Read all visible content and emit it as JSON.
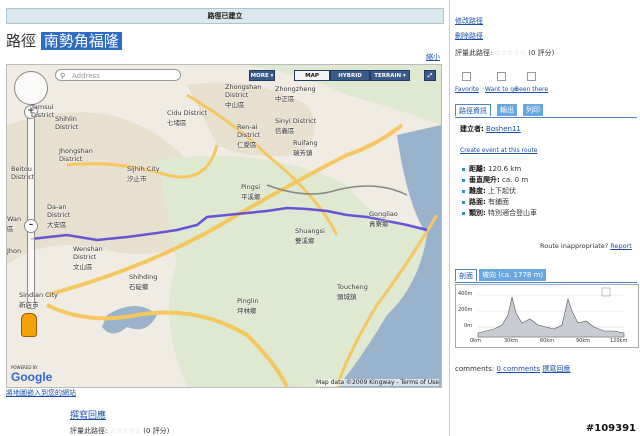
{
  "banner": "路徑已建立",
  "route": {
    "label": "路徑",
    "name": "南勢角福隆"
  },
  "shrink_link": "縮小",
  "map": {
    "search_placeholder": "Address",
    "types": [
      {
        "label": "MORE ▾",
        "active": false
      },
      {
        "label": "MAP",
        "active": true
      },
      {
        "label": "HYBRID",
        "active": false
      },
      {
        "label": "TERRAIN ▾",
        "active": false
      }
    ],
    "labels": {
      "shihlin": "Shihlin\nDistrict",
      "tamsui": "Tamsui\nDistrict",
      "beitou": "Beitou\nDistrict",
      "cidu": "Cidu District\n七堵區",
      "zhongshan": "Zhongshan\nDistrict\n中山區",
      "zhongzheng": "Zhongzheng\n中正區",
      "renai": "Ren-ai\nDistrict\n仁愛區",
      "sinyi": "Sinyi District\n信義區",
      "ruifang": "Ruifang\n瑞芳鎮",
      "jhongshan": "Jhongshan\nDistrict",
      "sijhih": "Sijhih City\n汐止市",
      "daan": "Da-an\nDistrict\n大安區",
      "wan": "Wan\n區",
      "jhon": "Jhon",
      "pingsi": "Pingsi\n平溪鄉",
      "gongliao": "Gongliao\n貢寮鄉",
      "wenshan": "Wenshan\nDistrict\n文山區",
      "shuangsi": "Shuangsi\n雙溪鄉",
      "shihding": "Shihding\n石碇鄉",
      "sindian": "Sindian City\n新店市",
      "pinglin": "Pinglin\n坪林鄉",
      "toucheng": "Toucheng\n頭城鎮"
    },
    "powered_by": "POWERED BY",
    "brand": "Google",
    "copyright": "Map data ©2009 Kingway - Terms of Use"
  },
  "embed_link": "將地圖嵌入到您的網站",
  "write_review": "撰寫回應",
  "rate_label": "評量此路徑:",
  "rate_count": "(0 評分)",
  "right": {
    "edit_link": "修改路徑",
    "delete_link": "刪除路徑",
    "rate_label": "評量此路徑:",
    "rate_count": "(0 評分)",
    "actions": [
      "Favorite",
      "Want to go",
      "Been there"
    ],
    "tabs": [
      {
        "label": "路徑資訊",
        "active": true
      },
      {
        "label": "輸出",
        "active": false
      },
      {
        "label": "列印",
        "active": false
      }
    ],
    "creator_label": "建立者:",
    "creator_name": "Boshen11",
    "create_event": "Create event at this route",
    "info": [
      {
        "k": "距離:",
        "v": "120.6 km"
      },
      {
        "k": "垂直爬升:",
        "v": "ca. 0 m"
      },
      {
        "k": "難度:",
        "v": "上下起伏"
      },
      {
        "k": "路面:",
        "v": "有鋪面"
      },
      {
        "k": "類別:",
        "v": "特別適合登山車"
      }
    ],
    "inappropriate": "Route inappropriate?",
    "report": "Report",
    "elev_tabs": [
      {
        "label": "剖面",
        "active": true
      },
      {
        "label": "坡向 (ca. 1778 m)",
        "active": false
      }
    ],
    "elev_chart": {
      "y_ticks": [
        "400m",
        "200m",
        "0m"
      ],
      "x_ticks": [
        "0km",
        "30km",
        "60km",
        "90km",
        "120km"
      ]
    },
    "comments_label": "comments:",
    "comments_count": "0 comments",
    "comments_link": "撰寫回應"
  },
  "watermark": "#109391"
}
